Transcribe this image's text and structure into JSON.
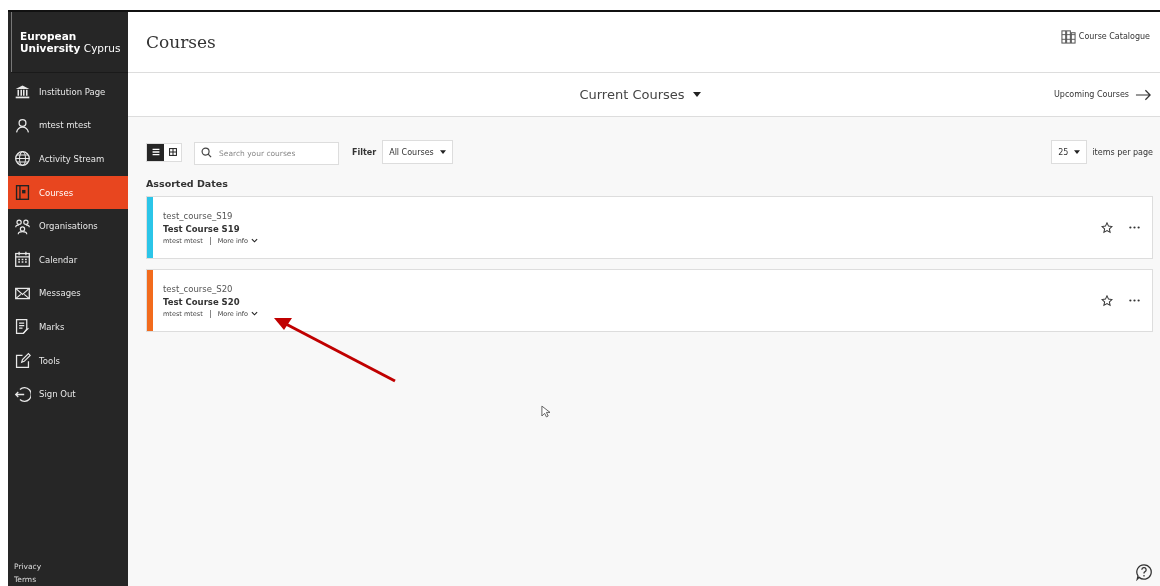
{
  "sidebar": {
    "brand_line_1": "European",
    "brand_line_2": "**University** Cyprus",
    "items": [
      {
        "kind": "institution",
        "label": "Institution Page",
        "selected": false
      },
      {
        "kind": "person",
        "label": "mtest mtest",
        "selected": false
      },
      {
        "kind": "globe",
        "label": "Activity Stream",
        "selected": false
      },
      {
        "kind": "courses",
        "label": "Courses",
        "selected": true
      },
      {
        "kind": "people",
        "label": "Organisations",
        "selected": false
      },
      {
        "kind": "calendar",
        "label": "Calendar",
        "selected": false
      },
      {
        "kind": "mail",
        "label": "Messages",
        "selected": false
      },
      {
        "kind": "marks",
        "label": "Marks",
        "selected": false
      },
      {
        "kind": "tools",
        "label": "Tools",
        "selected": false
      },
      {
        "kind": "signout",
        "label": "Sign Out",
        "selected": false
      }
    ],
    "footer_links": [
      "Privacy",
      "Terms"
    ]
  },
  "header": {
    "title": "Courses",
    "catalogue_link": "Course Catalogue"
  },
  "term_bar": {
    "current": "Current Courses",
    "upcoming": "Upcoming Courses"
  },
  "toolbar": {
    "views": [
      {
        "kind": "list",
        "selected": true
      },
      {
        "kind": "grid",
        "selected": false
      }
    ],
    "search": {
      "placeholder": "Search your courses"
    },
    "filter_label": "Filter",
    "filter_value": "All Courses",
    "per_page_value": "25",
    "per_page_label": "items per page"
  },
  "section_title": "Assorted Dates",
  "courses": [
    {
      "id": "test_course_S19",
      "name": "Test Course S19",
      "instructor": "mtest mtest",
      "more": "More info",
      "color": "#2bc5e8",
      "starred": false
    },
    {
      "id": "test_course_S20",
      "name": "Test Course S20",
      "instructor": "mtest mtest",
      "more": "More info",
      "color": "#f26b1d",
      "starred": false
    }
  ]
}
